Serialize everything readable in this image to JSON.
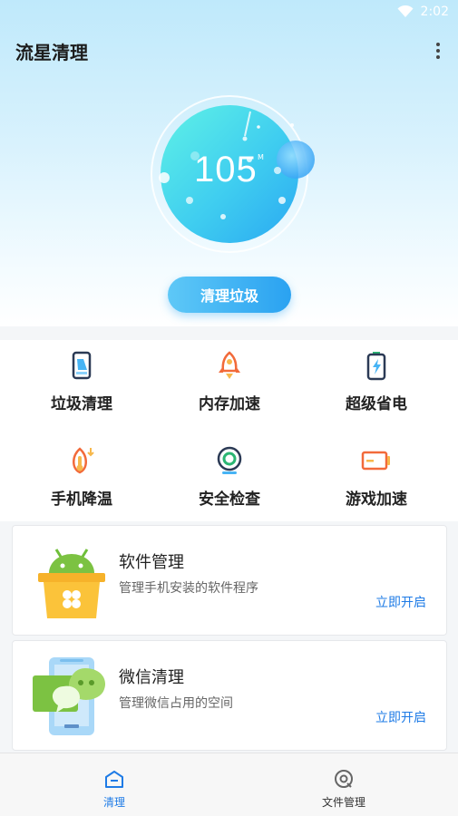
{
  "status_bar": {
    "time": "2:02",
    "wifi_icon": "wifi-icon"
  },
  "header": {
    "title": "流星清理",
    "menu_icon": "more-vertical-icon"
  },
  "gauge": {
    "value": "105",
    "unit": "M"
  },
  "clean_button": {
    "label": "清理垃圾"
  },
  "features": [
    {
      "label": "垃圾清理",
      "icon": "junk-clean-icon"
    },
    {
      "label": "内存加速",
      "icon": "rocket-boost-icon"
    },
    {
      "label": "超级省电",
      "icon": "battery-saver-icon"
    },
    {
      "label": "手机降温",
      "icon": "cool-down-icon"
    },
    {
      "label": "安全检查",
      "icon": "security-check-icon"
    },
    {
      "label": "游戏加速",
      "icon": "game-boost-icon"
    }
  ],
  "cards": [
    {
      "title": "软件管理",
      "desc": "管理手机安装的软件程序",
      "action": "立即开启",
      "icon": "android-app-icon"
    },
    {
      "title": "微信清理",
      "desc": "管理微信占用的空间",
      "action": "立即开启",
      "icon": "wechat-clean-icon"
    }
  ],
  "bottom_nav": [
    {
      "label": "清理",
      "icon": "clean-tab-icon",
      "active": true
    },
    {
      "label": "文件管理",
      "icon": "file-manage-icon",
      "active": false
    }
  ],
  "colors": {
    "accent": "#2aa2f1",
    "active_tab": "#1e7be6",
    "gauge": "#47d6f0"
  }
}
